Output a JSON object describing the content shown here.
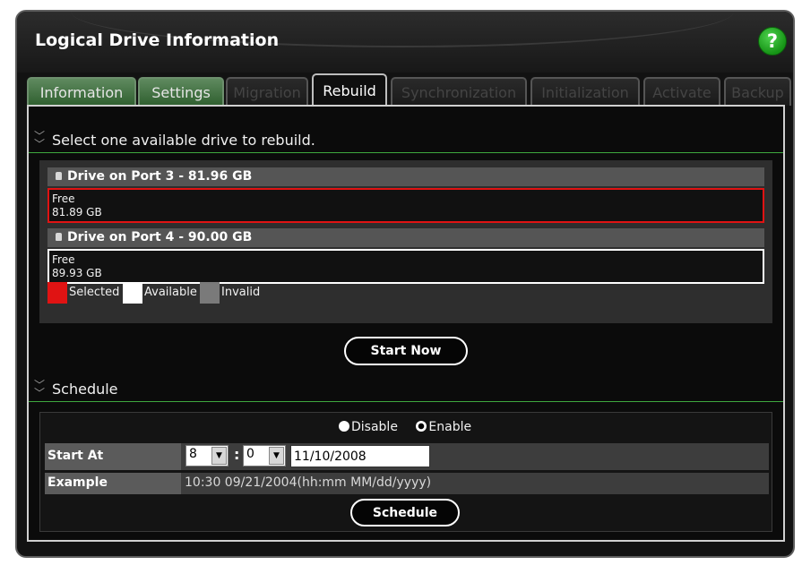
{
  "window": {
    "title": "Logical Drive Information",
    "help_symbol": "?"
  },
  "tabs": [
    {
      "label": "Information",
      "state": "enabled"
    },
    {
      "label": "Settings",
      "state": "enabled"
    },
    {
      "label": "Migration",
      "state": "disabled"
    },
    {
      "label": "Rebuild",
      "state": "active"
    },
    {
      "label": "Synchronization",
      "state": "disabled"
    },
    {
      "label": "Initialization",
      "state": "disabled"
    },
    {
      "label": "Activate",
      "state": "disabled"
    },
    {
      "label": "Backup",
      "state": "disabled"
    }
  ],
  "rebuild": {
    "section_label": "Select one available drive to rebuild.",
    "drives": [
      {
        "name": "Drive on Port 3 - 81.96 GB",
        "slot_status": "Free",
        "slot_size": "81.89 GB",
        "state": "selected"
      },
      {
        "name": "Drive on Port 4 - 90.00 GB",
        "slot_status": "Free",
        "slot_size": "89.93 GB",
        "state": "available"
      }
    ],
    "legend": [
      {
        "label": "Selected",
        "color": "#e01313"
      },
      {
        "label": "Available",
        "color": "#ffffff"
      },
      {
        "label": "Invalid",
        "color": "#7a7a7a"
      }
    ],
    "start_now_label": "Start Now"
  },
  "schedule": {
    "section_label": "Schedule",
    "disable_label": "Disable",
    "enable_label": "Enable",
    "selected_option": "Enable",
    "start_at_label": "Start At",
    "hour_value": "8",
    "minute_value": "0",
    "time_separator": ":",
    "date_value": "11/10/2008",
    "example_label": "Example",
    "example_value": "10:30 09/21/2004(hh:mm MM/dd/yyyy)",
    "schedule_button_label": "Schedule"
  },
  "colors": {
    "accent_green": "#3ea83e",
    "selected_red": "#e01313"
  }
}
